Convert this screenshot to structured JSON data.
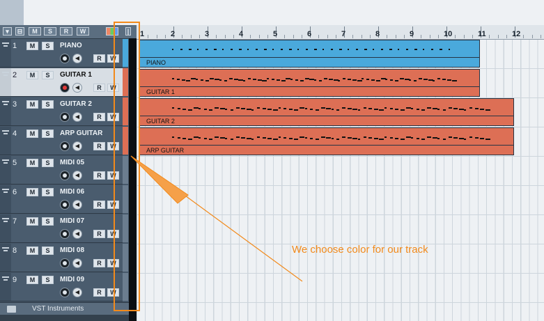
{
  "toolbar": {
    "buttons": [
      "▾",
      "⊟",
      "M",
      "S",
      "R",
      "W"
    ],
    "color_btn": "color-tool",
    "mini_btn": "|"
  },
  "ruler": {
    "bars": [
      "1",
      "2",
      "3",
      "4",
      "5",
      "6",
      "7",
      "8",
      "9",
      "10",
      "11",
      "12"
    ]
  },
  "tracks": [
    {
      "num": "1",
      "name": "PIANO",
      "color": "#4aa9dc",
      "armed": false,
      "selected": false
    },
    {
      "num": "2",
      "name": "GUITAR 1",
      "color": "#dd6f55",
      "armed": true,
      "selected": true
    },
    {
      "num": "3",
      "name": "GUITAR 2",
      "color": "#dd6f55",
      "armed": false,
      "selected": false
    },
    {
      "num": "4",
      "name": "ARP GUITAR",
      "color": "#dd6f55",
      "armed": false,
      "selected": false
    },
    {
      "num": "5",
      "name": "MIDI 05",
      "color": "",
      "armed": false,
      "selected": false
    },
    {
      "num": "6",
      "name": "MIDI 06",
      "color": "",
      "armed": false,
      "selected": false
    },
    {
      "num": "7",
      "name": "MIDI 07",
      "color": "",
      "armed": false,
      "selected": false
    },
    {
      "num": "8",
      "name": "MIDI 08",
      "color": "",
      "armed": false,
      "selected": false
    },
    {
      "num": "9",
      "name": "MIDI 09",
      "color": "",
      "armed": false,
      "selected": false
    }
  ],
  "track_buttons": {
    "mute": "M",
    "solo": "S",
    "read": "R",
    "write": "W"
  },
  "parts": [
    {
      "track": 0,
      "label": "PIANO",
      "color": "#4aa9dc",
      "end_bar": 10.97
    },
    {
      "track": 1,
      "label": "GUITAR 1",
      "color": "#dd6f55",
      "end_bar": 10.97
    },
    {
      "track": 2,
      "label": "GUITAR 2",
      "color": "#dd6f55",
      "end_bar": 11.97
    },
    {
      "track": 3,
      "label": "ARP GUITAR",
      "color": "#dd6f55",
      "end_bar": 11.97
    }
  ],
  "vst_label": "VST Instruments",
  "annotation": {
    "text": "We choose color for our track",
    "color": "#f28a1b"
  }
}
